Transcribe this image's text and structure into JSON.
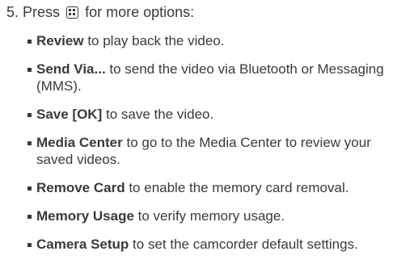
{
  "step": {
    "number": "5.",
    "text_before": "Press",
    "key_icon": "menu-key-icon",
    "text_after": "for more options:"
  },
  "options": [
    {
      "term": "Review",
      "desc": " to play back the video."
    },
    {
      "term": "Send Via...",
      "desc": " to send the video via Bluetooth or Messaging (MMS)."
    },
    {
      "term": "Save [OK]",
      "desc": " to save the video."
    },
    {
      "term": "Media Center",
      "desc": " to go to the Media Center to review your saved videos."
    },
    {
      "term": "Remove Card",
      "desc": " to enable the memory card removal."
    },
    {
      "term": "Memory Usage",
      "desc": " to verify memory usage."
    },
    {
      "term": "Camera Setup",
      "desc": " to set the camcorder default settings."
    }
  ]
}
